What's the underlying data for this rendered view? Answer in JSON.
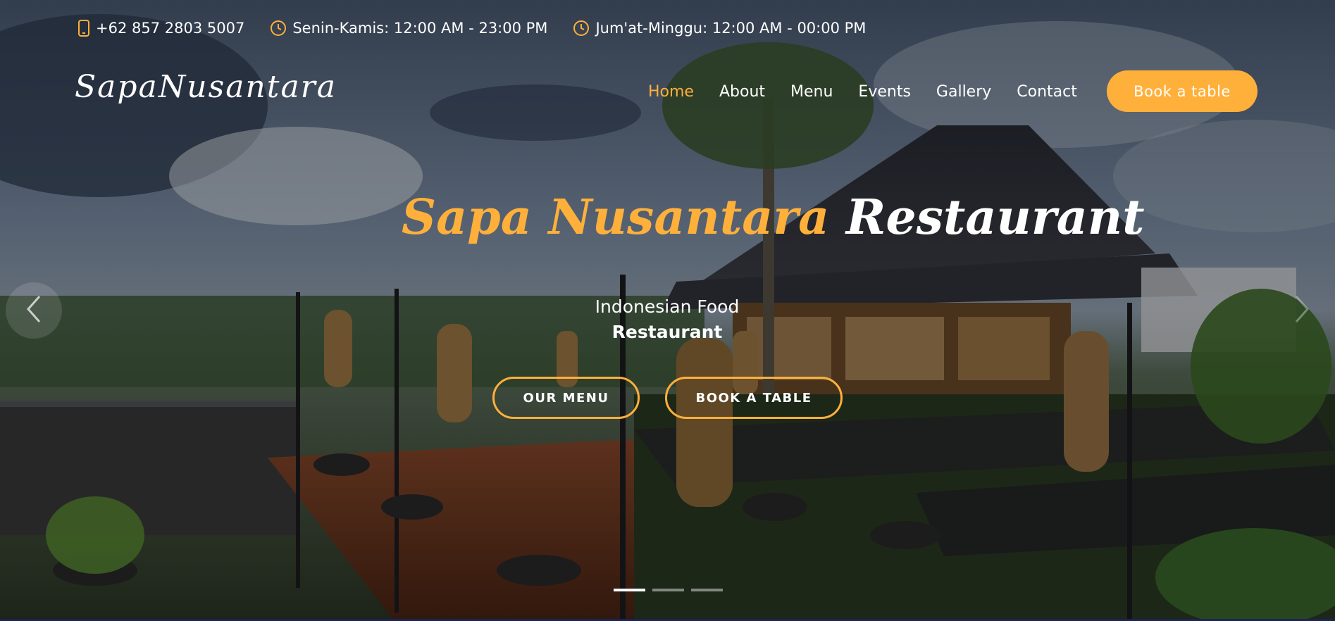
{
  "topbar": {
    "phone": "+62 857 2803 5007",
    "hours_weekday": "Senin-Kamis: 12:00 AM - 23:00 PM",
    "hours_weekend": "Jum'at-Minggu: 12:00 AM - 00:00 PM",
    "icons": [
      "phone-icon",
      "clock-icon",
      "clock-icon"
    ]
  },
  "header": {
    "logo": "SapaNusantara",
    "nav": [
      {
        "label": "Home",
        "active": true
      },
      {
        "label": "About"
      },
      {
        "label": "Menu"
      },
      {
        "label": "Events"
      },
      {
        "label": "Gallery"
      },
      {
        "label": "Contact"
      }
    ],
    "book_button": "Book a table"
  },
  "hero": {
    "title_accent": "Sapa Nusantara",
    "title_white": "Restaurant",
    "subtitle_line1": "Indonesian Food",
    "subtitle_line2": "Restaurant",
    "cta_menu": "OUR MENU",
    "cta_book": "BOOK A TABLE"
  },
  "carousel": {
    "slides": 3,
    "active_index": 0,
    "prev_icon": "chevron-left-icon",
    "next_icon": "chevron-right-icon"
  },
  "colors": {
    "accent": "#ffb03b",
    "text": "#ffffff"
  }
}
